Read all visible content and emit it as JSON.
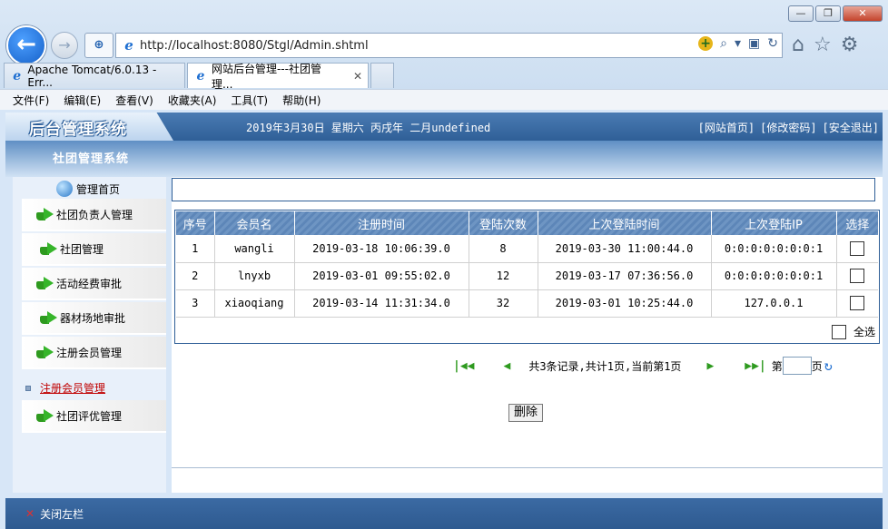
{
  "browser": {
    "window_buttons": [
      "—",
      "❐",
      "✕"
    ],
    "url": "http://localhost:8080/Stgl/Admin.shtml",
    "tabs": [
      {
        "title": "Apache Tomcat/6.0.13 - Err...",
        "active": false
      },
      {
        "title": "网站后台管理---社团管理...",
        "active": true
      }
    ],
    "menu": [
      "文件(F)",
      "编辑(E)",
      "查看(V)",
      "收藏夹(A)",
      "工具(T)",
      "帮助(H)"
    ],
    "icons": [
      "back-arrow-icon",
      "forward-arrow-icon",
      "compat-view-icon",
      "search-icon",
      "refresh-icon",
      "home-icon",
      "favorites-star-icon",
      "settings-gear-icon"
    ]
  },
  "header": {
    "logo": "后台管理系统",
    "date": "2019年3月30日 星期六 丙戌年 二月undefined",
    "links": [
      "[网站首页]",
      "[修改密码]",
      "[安全退出]"
    ],
    "system_name": "社团管理系统"
  },
  "sidebar": {
    "home": "管理首页",
    "items": [
      {
        "label": "社团负责人管理"
      },
      {
        "label": "社团管理"
      },
      {
        "label": "活动经费审批"
      },
      {
        "label": "器材场地审批"
      },
      {
        "label": "注册会员管理"
      }
    ],
    "sub_link": "注册会员管理",
    "last_item": "社团评优管理"
  },
  "table": {
    "columns": [
      "序号",
      "会员名",
      "注册时间",
      "登陆次数",
      "上次登陆时间",
      "上次登陆IP",
      "选择"
    ],
    "rows": [
      [
        "1",
        "wangli",
        "2019-03-18 10:06:39.0",
        "8",
        "2019-03-30 11:00:44.0",
        "0:0:0:0:0:0:0:1"
      ],
      [
        "2",
        "lnyxb",
        "2019-03-01 09:55:02.0",
        "12",
        "2019-03-17 07:36:56.0",
        "0:0:0:0:0:0:0:1"
      ],
      [
        "3",
        "xiaoqiang",
        "2019-03-14 11:31:34.0",
        "32",
        "2019-03-01 10:25:44.0",
        "127.0.0.1"
      ]
    ],
    "select_all": "全选"
  },
  "pager": {
    "summary": "共3条记录,共计1页,当前第1页",
    "page_prefix": "第",
    "page_suffix": "页",
    "page_value": ""
  },
  "actions": {
    "delete": "删除"
  },
  "footer": {
    "close_left": "关闭左栏"
  }
}
